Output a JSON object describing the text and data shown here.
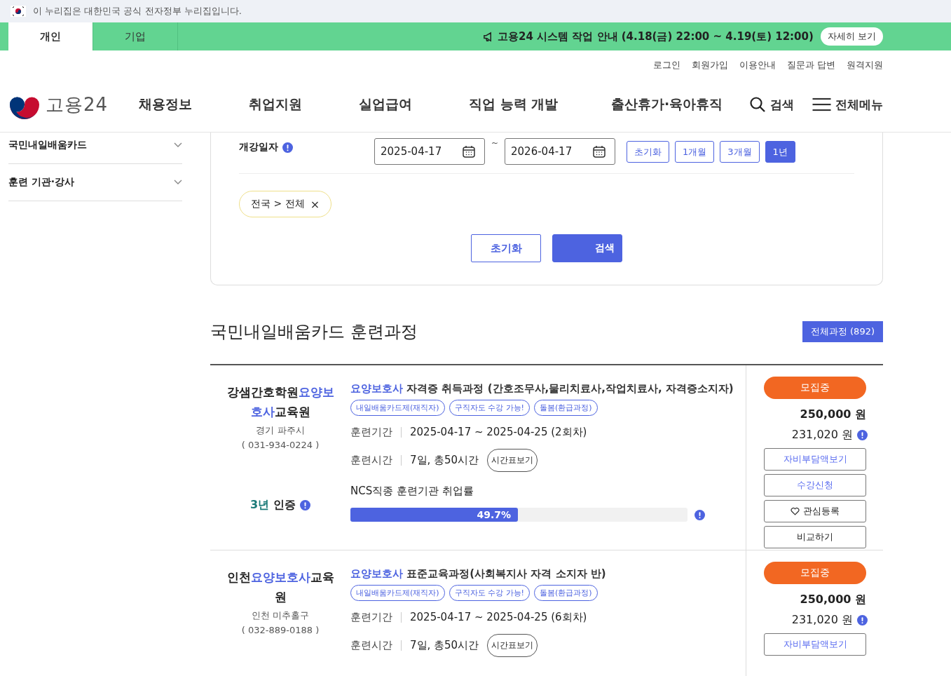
{
  "gov_banner": {
    "text": "이 누리집은 대한민국 공식 전자정부 누리집입니다."
  },
  "audience_tabs": [
    {
      "label": "개인",
      "selected": true
    },
    {
      "label": "기업",
      "selected": false
    }
  ],
  "notice": {
    "text": "고용24 시스템 작업 안내 (4.18(금) 22:00 ~ 4.19(토) 12:00)",
    "button": "자세히 보기"
  },
  "utility_links": [
    "로그인",
    "회원가입",
    "이용안내",
    "질문과 답변",
    "원격지원"
  ],
  "logo": {
    "text": "고용24"
  },
  "nav": [
    "채용정보",
    "취업지원",
    "실업급여",
    "직업 능력 개발",
    "출산휴가·육아휴직"
  ],
  "search_label": "검색",
  "menu_label": "전체메뉴",
  "sidebar": {
    "items": [
      {
        "label": "국민내일배움카드",
        "expanded": false
      },
      {
        "label": "훈련 기관·강사",
        "expanded": false
      }
    ]
  },
  "filter": {
    "date_label": "개강일자",
    "start_date": "2025-04-17",
    "separator": "~",
    "end_date": "2026-04-17",
    "quick_ranges": [
      {
        "label": "초기화",
        "selected": false
      },
      {
        "label": "1개월",
        "selected": false
      },
      {
        "label": "3개월",
        "selected": false
      },
      {
        "label": "1년",
        "selected": true
      }
    ],
    "region_chip": "전국 > 전체",
    "chip_remove": "×",
    "reset_button": "초기화",
    "search_button": "검색"
  },
  "results": {
    "title": "국민내일배움카드 훈련과정",
    "all_courses_button": "전체과정 (892)",
    "courses": [
      {
        "org": "강샘간호학원**요양보호사**교육원",
        "region": "경기 파주시",
        "phone": "( 031-934-0224 )",
        "title": "**요양보호사** 자격증 취득과정 (간호조무사,물리치료사,작업치료사, 자격증소지자)",
        "tags": [
          "내일배움카드제(재직자)",
          "구직자도 수강 가능!",
          "돌봄(환급과정)"
        ],
        "period_label": "훈련기간",
        "period": "2025-04-17 ~ 2025-04-25 (2회차)",
        "hours_label": "훈련시간",
        "hours": "7일, 총50시간",
        "timetable_button": "시간표보기",
        "ncs_label": "NCS직종 훈련기관 취업률",
        "employment_rate": {
          "level": 0.497,
          "reading": "49.7%"
        },
        "cert_years": "3년",
        "cert_label": "인증",
        "status": "모집중",
        "price": "250,000 원",
        "self_pay": "231,020 원",
        "buttons": [
          {
            "label": "자비부담액보기",
            "kind": "accent"
          },
          {
            "label": "수강신청",
            "kind": "accent"
          },
          {
            "label": "관심등록",
            "kind": "favorite"
          },
          {
            "label": "비교하기",
            "kind": "plain"
          }
        ]
      },
      {
        "org": "인천**요양보호사**교육원",
        "region": "인천 미추홀구",
        "phone": "( 032-889-0188 )",
        "title": "**요양보호사** 표준교육과정(사회복지사 자격 소지자 반)",
        "tags": [
          "내일배움카드제(재직자)",
          "구직자도 수강 가능!",
          "돌봄(환급과정)"
        ],
        "period_label": "훈련기간",
        "period": "2025-04-17 ~ 2025-04-25 (6회차)",
        "hours_label": "훈련시간",
        "hours": "7일, 총50시간",
        "timetable_button": "시간표보기",
        "status": "모집중",
        "price": "250,000 원",
        "self_pay": "231,020 원",
        "buttons": [
          {
            "label": "자비부담액보기",
            "kind": "accent"
          }
        ]
      }
    ]
  }
}
